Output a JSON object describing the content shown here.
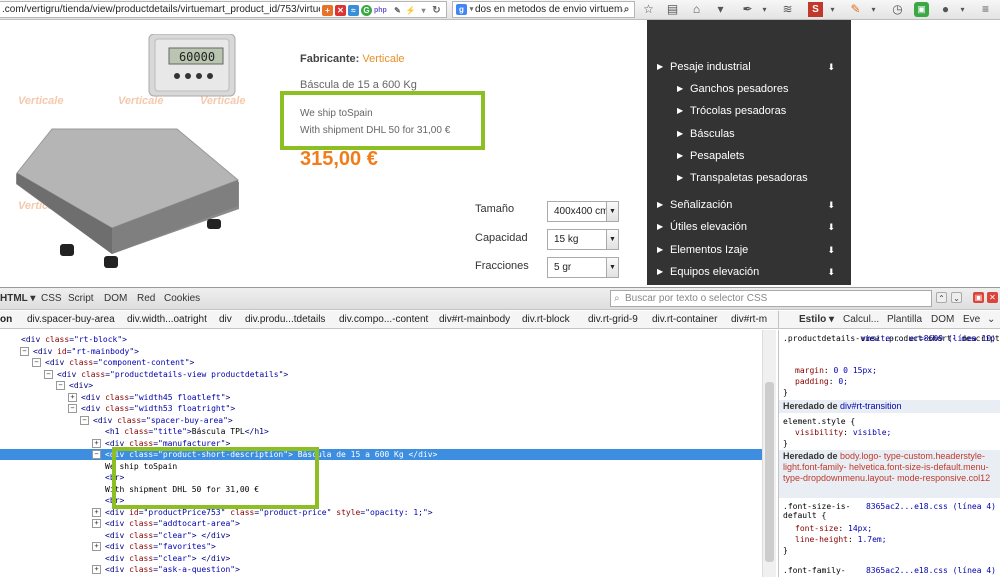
{
  "browser": {
    "url": ".com/vertigru/tienda/view/productdetails/virtuemart_product_id/753/virtuemart_c",
    "search_query": "dos en metodos de envio virtuemart"
  },
  "product": {
    "manufacturer_label": "Fabricante:",
    "manufacturer_name": "Verticale",
    "short_description": "Báscula de 15 a 600 Kg",
    "ship_line_1": "We ship toSpain",
    "ship_line_2": "With shipment DHL 50 for 31,00 €",
    "price": "315,00 €",
    "watermark": "Verticale",
    "display_value": "60000",
    "options": [
      {
        "label": "Tamaño",
        "value": "400x400 cm"
      },
      {
        "label": "Capacidad",
        "value": "15 kg"
      },
      {
        "label": "Fracciones",
        "value": "5 gr"
      }
    ]
  },
  "menu": {
    "items": [
      {
        "label": "Pesaje industrial",
        "level": 0
      },
      {
        "label": "Ganchos pesadores",
        "level": 1
      },
      {
        "label": "Trócolas pesadoras",
        "level": 1
      },
      {
        "label": "Básculas",
        "level": 1
      },
      {
        "label": "Pesapalets",
        "level": 1
      },
      {
        "label": "Transpaletas pesadoras",
        "level": 1
      },
      {
        "label": "Señalización",
        "level": 0
      },
      {
        "label": "Útiles elevación",
        "level": 0
      },
      {
        "label": "Elementos Izaje",
        "level": 0
      },
      {
        "label": "Equipos elevación",
        "level": 0
      }
    ]
  },
  "devtools": {
    "tabs": [
      "HTML",
      "CSS",
      "Script",
      "DOM",
      "Red",
      "Cookies"
    ],
    "search_placeholder": "Buscar por texto o selector CSS",
    "breadcrumbs": [
      "on",
      "div.spacer-buy-area",
      "div.width...oatright",
      "div",
      "div.produ...tdetails",
      "div.compo...-content",
      "div#rt-mainbody",
      "div.rt-block",
      "div.rt-grid-9",
      "div.rt-container",
      "div#rt-m"
    ],
    "side_tabs": [
      "Estilo",
      "Calcul...",
      "Plantilla",
      "DOM",
      "Eve"
    ],
    "html_lines": [
      {
        "indent": 0,
        "tw": "",
        "parts": [
          [
            "tag",
            "<div "
          ],
          [
            "attr",
            "class"
          ],
          [
            "tag",
            "=\""
          ],
          [
            "val",
            "rt-block"
          ],
          [
            "tag",
            "\">"
          ]
        ]
      },
      {
        "indent": 1,
        "tw": "−",
        "parts": [
          [
            "tag",
            "<div "
          ],
          [
            "attr",
            "id"
          ],
          [
            "tag",
            "=\""
          ],
          [
            "val",
            "rt-mainbody"
          ],
          [
            "tag",
            "\">"
          ]
        ]
      },
      {
        "indent": 2,
        "tw": "−",
        "parts": [
          [
            "tag",
            "<div "
          ],
          [
            "attr",
            "class"
          ],
          [
            "tag",
            "=\""
          ],
          [
            "val",
            "component-content"
          ],
          [
            "tag",
            "\">"
          ]
        ]
      },
      {
        "indent": 3,
        "tw": "−",
        "parts": [
          [
            "tag",
            "<div "
          ],
          [
            "attr",
            "class"
          ],
          [
            "tag",
            "=\""
          ],
          [
            "val",
            "productdetails-view productdetails"
          ],
          [
            "tag",
            "\">"
          ]
        ]
      },
      {
        "indent": 4,
        "tw": "−",
        "parts": [
          [
            "tag",
            "<div>"
          ]
        ]
      },
      {
        "indent": 5,
        "tw": "+",
        "parts": [
          [
            "tag",
            "<div "
          ],
          [
            "attr",
            "class"
          ],
          [
            "tag",
            "=\""
          ],
          [
            "val",
            "width45 floatleft"
          ],
          [
            "tag",
            "\">"
          ]
        ]
      },
      {
        "indent": 5,
        "tw": "−",
        "parts": [
          [
            "tag",
            "<div "
          ],
          [
            "attr",
            "class"
          ],
          [
            "tag",
            "=\""
          ],
          [
            "val",
            "width53 floatright"
          ],
          [
            "tag",
            "\">"
          ]
        ]
      },
      {
        "indent": 6,
        "tw": "−",
        "parts": [
          [
            "tag",
            "<div "
          ],
          [
            "attr",
            "class"
          ],
          [
            "tag",
            "=\""
          ],
          [
            "val",
            "spacer-buy-area"
          ],
          [
            "tag",
            "\">"
          ]
        ]
      },
      {
        "indent": 7,
        "tw": "",
        "parts": [
          [
            "tag",
            "<h1 "
          ],
          [
            "attr",
            "class"
          ],
          [
            "tag",
            "=\""
          ],
          [
            "val",
            "title"
          ],
          [
            "tag",
            "\">"
          ],
          [
            "txt",
            "Báscula TPL"
          ],
          [
            "tag",
            "</h1>"
          ]
        ]
      },
      {
        "indent": 7,
        "tw": "+",
        "parts": [
          [
            "tag",
            "<div "
          ],
          [
            "attr",
            "class"
          ],
          [
            "tag",
            "=\""
          ],
          [
            "val",
            "manufacturer"
          ],
          [
            "tag",
            "\">"
          ]
        ]
      },
      {
        "indent": 7,
        "tw": "−",
        "sel": true,
        "parts": [
          [
            "tag",
            "<div "
          ],
          [
            "attr",
            "class"
          ],
          [
            "tag",
            "=\""
          ],
          [
            "val",
            "product-short-description"
          ],
          [
            "tag",
            "\"> "
          ],
          [
            "txt",
            "Báscula de 15 a 600 Kg "
          ],
          [
            "tag",
            "</div>"
          ]
        ]
      },
      {
        "indent": 7,
        "tw": "",
        "parts": [
          [
            "txt",
            "We ship toSpain"
          ]
        ]
      },
      {
        "indent": 7,
        "tw": "",
        "parts": [
          [
            "tag",
            "<br>"
          ]
        ]
      },
      {
        "indent": 7,
        "tw": "",
        "parts": [
          [
            "txt",
            "With shipment DHL 50 for 31,00 €"
          ]
        ]
      },
      {
        "indent": 7,
        "tw": "",
        "parts": [
          [
            "tag",
            "<br>"
          ]
        ]
      },
      {
        "indent": 7,
        "tw": "+",
        "parts": [
          [
            "tag",
            "<div "
          ],
          [
            "attr",
            "id"
          ],
          [
            "tag",
            "=\""
          ],
          [
            "val",
            "productPrice753"
          ],
          [
            "tag",
            "\" "
          ],
          [
            "attr",
            "class"
          ],
          [
            "tag",
            "=\""
          ],
          [
            "val",
            "product-price"
          ],
          [
            "tag",
            "\" "
          ],
          [
            "attr",
            "style"
          ],
          [
            "tag",
            "=\""
          ],
          [
            "val",
            "opacity: 1;"
          ],
          [
            "tag",
            "\">"
          ]
        ]
      },
      {
        "indent": 7,
        "tw": "+",
        "parts": [
          [
            "tag",
            "<div "
          ],
          [
            "attr",
            "class"
          ],
          [
            "tag",
            "=\""
          ],
          [
            "val",
            "addtocart-area"
          ],
          [
            "tag",
            "\">"
          ]
        ]
      },
      {
        "indent": 7,
        "tw": "",
        "parts": [
          [
            "tag",
            "<div "
          ],
          [
            "attr",
            "class"
          ],
          [
            "tag",
            "=\""
          ],
          [
            "val",
            "clear"
          ],
          [
            "tag",
            "\"> </div>"
          ]
        ]
      },
      {
        "indent": 7,
        "tw": "+",
        "parts": [
          [
            "tag",
            "<div "
          ],
          [
            "attr",
            "class"
          ],
          [
            "tag",
            "=\""
          ],
          [
            "val",
            "favorites"
          ],
          [
            "tag",
            "\">"
          ]
        ]
      },
      {
        "indent": 7,
        "tw": "",
        "parts": [
          [
            "tag",
            "<div "
          ],
          [
            "attr",
            "class"
          ],
          [
            "tag",
            "=\""
          ],
          [
            "val",
            "clear"
          ],
          [
            "tag",
            "\"> </div>"
          ]
        ]
      },
      {
        "indent": 7,
        "tw": "+",
        "parts": [
          [
            "tag",
            "<div "
          ],
          [
            "attr",
            "class"
          ],
          [
            "tag",
            "=\""
          ],
          [
            "val",
            "ask-a-question"
          ],
          [
            "tag",
            "\">"
          ]
        ]
      }
    ],
    "styles": {
      "rule1_selector": ".productdetails-view .product-short- description {",
      "rule1_source": "vmsite-...er=8609 (línea 10)",
      "rule1_props": [
        [
          "margin",
          "0 0 15px;"
        ],
        [
          "padding",
          "0;"
        ]
      ],
      "inherit1_label": "Heredado de",
      "inherit1_selector": "div#rt-transition",
      "rule2_selector": "element.style {",
      "rule2_props": [
        [
          "visibility",
          "visible;"
        ]
      ],
      "inherit2_label": "Heredado de",
      "inherit2_selector": "body.logo- type-custom.headerstyle-light.font-family- helvetica.font-size-is-default.menu- type-dropdownmenu.layout- mode-responsive.col12",
      "rule3_selector": ".font-size-is- default {",
      "rule3_source": "8365ac2...e18.css (línea 4)",
      "rule3_props": [
        [
          "font-size",
          "14px;"
        ],
        [
          "line-height",
          "1.7em;"
        ]
      ],
      "rule4_selector": ".font-family-",
      "rule4_source": "8365ac2...e18.css (línea 4)"
    }
  },
  "colors": {
    "accent_orange": "#f07d1a",
    "highlight_green": "#8bbf24",
    "menu_bg": "#333333",
    "selection_blue": "#3d8ee0"
  }
}
